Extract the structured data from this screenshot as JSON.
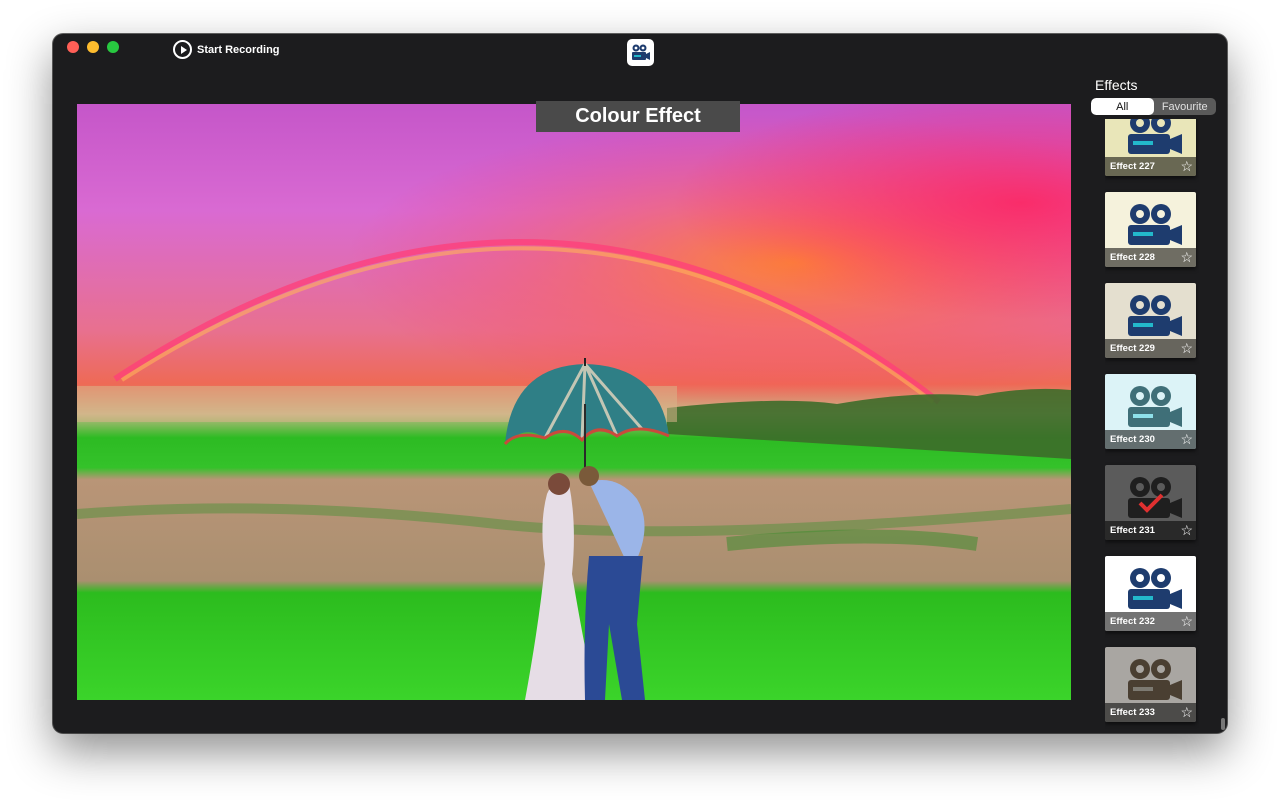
{
  "window": {
    "record_button": {
      "label": "Start Recording",
      "icon": "play-circle-icon"
    },
    "app_icon": "video-camera-icon"
  },
  "preview": {
    "overlay_title": "Colour Effect",
    "image": "rainbow-couple-umbrella-field"
  },
  "sidebar": {
    "title": "Effects",
    "tabs": [
      {
        "label": "All",
        "active": true
      },
      {
        "label": "Favourite",
        "active": false
      }
    ],
    "effects": [
      {
        "label": "Effect 227",
        "bg": "#e9e6b9",
        "favorite": false
      },
      {
        "label": "Effect 228",
        "bg": "#f5f2dc",
        "favorite": false
      },
      {
        "label": "Effect 229",
        "bg": "#e4dfcf",
        "favorite": false
      },
      {
        "label": "Effect 230",
        "bg": "#dcf3f7",
        "favorite": false
      },
      {
        "label": "Effect 231",
        "bg": "#5b5b5b",
        "favorite": false
      },
      {
        "label": "Effect 232",
        "bg": "#ffffff",
        "favorite": false
      },
      {
        "label": "Effect 233",
        "bg": "#a9a6a2",
        "favorite": false
      }
    ]
  }
}
